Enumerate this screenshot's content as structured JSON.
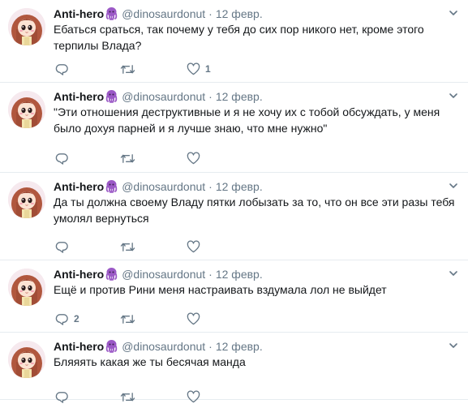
{
  "colors": {
    "text_primary": "#14171a",
    "text_secondary": "#657786",
    "divider": "#e6ecf0",
    "emoji_purple": "#9b59c6"
  },
  "icons": {
    "reply": "reply-icon",
    "retweet": "retweet-icon",
    "like": "like-icon",
    "more": "chevron-down-icon",
    "emoji": "octopus-emoji-icon"
  },
  "tweets": [
    {
      "name": "Anti-hero",
      "handle": "@dinosaurdonut",
      "dot": "·",
      "date": "12 февр.",
      "text": "Ебаться сраться, так почему у тебя до сих пор никого нет, кроме этого терпилы Влада?",
      "replies": "",
      "retweets": "",
      "likes": "1"
    },
    {
      "name": "Anti-hero",
      "handle": "@dinosaurdonut",
      "dot": "·",
      "date": "12 февр.",
      "text": "\"Эти отношения деструктивные и я не хочу их с тобой обсуждать, у меня было дохуя парней и я лучше знаю, что мне нужно\"",
      "replies": "",
      "retweets": "",
      "likes": ""
    },
    {
      "name": "Anti-hero",
      "handle": "@dinosaurdonut",
      "dot": "·",
      "date": "12 февр.",
      "text": "Да ты должна своему Владу пятки лобызать за то, что он все эти разы тебя умолял вернуться",
      "replies": "",
      "retweets": "",
      "likes": ""
    },
    {
      "name": "Anti-hero",
      "handle": "@dinosaurdonut",
      "dot": "·",
      "date": "12 февр.",
      "text": "Ещё и против Рини меня настраивать вздумала лол не выйдет",
      "replies": "2",
      "retweets": "",
      "likes": ""
    },
    {
      "name": "Anti-hero",
      "handle": "@dinosaurdonut",
      "dot": "·",
      "date": "12 февр.",
      "text": "Бляяять какая же ты бесячая манда",
      "replies": "",
      "retweets": "",
      "likes": ""
    }
  ]
}
